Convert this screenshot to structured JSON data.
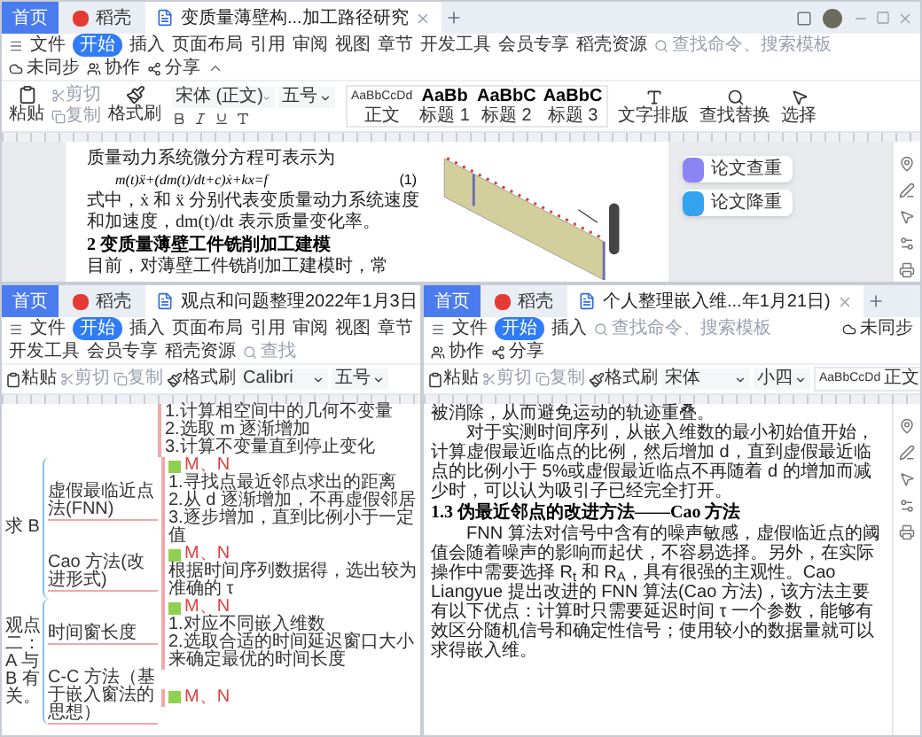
{
  "windows": [
    {
      "tabs": [
        {
          "label": "首页",
          "kind": "home",
          "selected": false
        },
        {
          "label": "稻壳",
          "kind": "daoke",
          "selected": false
        },
        {
          "label": "变质量薄壁构...加工路径研究",
          "kind": "doc",
          "selected": true
        }
      ],
      "menu": [
        {
          "label": "文件",
          "selected": false
        },
        {
          "label": "开始",
          "selected": true
        },
        {
          "label": "插入",
          "selected": false
        },
        {
          "label": "页面布局",
          "selected": false
        },
        {
          "label": "引用",
          "selected": false
        },
        {
          "label": "审阅",
          "selected": false
        },
        {
          "label": "视图",
          "selected": false
        },
        {
          "label": "章节",
          "selected": false
        },
        {
          "label": "开发工具",
          "selected": false
        },
        {
          "label": "会员专享",
          "selected": false
        },
        {
          "label": "稻壳资源",
          "selected": false
        }
      ],
      "search": {
        "placeholder": "查找命令、搜索模板"
      },
      "actions": [
        "未同步",
        "协作",
        "分享"
      ],
      "ribbon": {
        "clipboard": [
          "粘贴",
          "剪切",
          "复制",
          "格式刷"
        ],
        "font": "宋体 (正文)",
        "size": "五号",
        "styles": [
          {
            "sample": "AaBbCcDd",
            "label": "正文"
          },
          {
            "sample": "AaBb",
            "label": "标题 1"
          },
          {
            "sample": "AaBbC",
            "label": "标题 2"
          },
          {
            "sample": "AaBbC",
            "label": "标题 3"
          }
        ],
        "tools": [
          "文字排版",
          "查找替换",
          "选择"
        ]
      },
      "content": {
        "kind": "paper",
        "paragraphs": [
          {
            "kind": "text",
            "text": "质量动力系统微分方程可表示为"
          },
          {
            "kind": "formula",
            "text": "m(t)ẍ+(dm(t)/dt+c)ẋ+kx=f",
            "number": "(1)"
          },
          {
            "kind": "text",
            "text": "式中，ẋ 和 ẍ 分别代表变质量动力系统速度"
          },
          {
            "kind": "text",
            "text": "和加速度，dm(t)/dt 表示质量变化率。"
          },
          {
            "kind": "heading",
            "text": "2 变质量薄壁工件铣削加工建模"
          },
          {
            "kind": "text",
            "text": "目前，对薄壁工件铣削加工建模时，常"
          }
        ],
        "side_buttons": [
          "论文查重",
          "论文降重"
        ]
      }
    },
    {
      "tabs": [
        {
          "label": "首页",
          "kind": "home",
          "selected": false
        },
        {
          "label": "稻壳",
          "kind": "daoke",
          "selected": false
        },
        {
          "label": "观点和问题整理2022年1月3日",
          "kind": "doc",
          "selected": true
        }
      ],
      "menu": [
        {
          "label": "文件",
          "selected": false
        },
        {
          "label": "开始",
          "selected": true
        },
        {
          "label": "插入",
          "selected": false
        },
        {
          "label": "页面布局",
          "selected": false
        },
        {
          "label": "引用",
          "selected": false
        },
        {
          "label": "审阅",
          "selected": false
        },
        {
          "label": "视图",
          "selected": false
        },
        {
          "label": "章节",
          "selected": false
        },
        {
          "label": "开发工具",
          "selected": false
        },
        {
          "label": "会员专享",
          "selected": false
        },
        {
          "label": "稻壳资源",
          "selected": false
        }
      ],
      "search": {
        "placeholder": "查找"
      },
      "ribbon": {
        "clipboard": [
          "粘贴",
          "剪切",
          "复制",
          "格式刷"
        ],
        "font": "Calibri",
        "size": "五号"
      },
      "content": {
        "kind": "mindmap",
        "top_notes": [
          "1.计算相空间中的几何不变量",
          "2.选取 m 逐渐增加",
          "3.计算不变量直到停止变化"
        ],
        "groups": [
          {
            "label": "求 B",
            "branches": [
              {
                "label": "虚假最临近点法(FNN)",
                "tag": "M、N",
                "notes": [
                  "1.寻找点最近邻点求出的距离",
                  "2.从 d 逐渐增加，不再虚假邻居",
                  "3.逐步增加，直到比例小于一定值"
                ]
              },
              {
                "label": "Cao 方法(改进形式)",
                "tag": "M、N",
                "notes": [
                  "根据时间序列数据得，选出较为准确的 τ"
                ]
              }
            ]
          },
          {
            "label": "观点二：A 与 B 有关。",
            "branches": [
              {
                "label": "时间窗长度",
                "tag": "M、N",
                "notes": [
                  "1.对应不同嵌入维数",
                  "2.选取合适的时间延迟窗口大小来确定最优的时间长度"
                ]
              },
              {
                "label": "C-C 方法（基于嵌入窗法的思想）",
                "tag": "M、N"
              }
            ]
          }
        ]
      }
    },
    {
      "tabs": [
        {
          "label": "首页",
          "kind": "home",
          "selected": false
        },
        {
          "label": "稻壳",
          "kind": "daoke",
          "selected": false
        },
        {
          "label": "个人整理嵌入维...年1月21日)",
          "kind": "doc",
          "selected": true
        }
      ],
      "menu": [
        {
          "label": "文件",
          "selected": false
        },
        {
          "label": "开始",
          "selected": true
        },
        {
          "label": "插入",
          "selected": false
        }
      ],
      "search": {
        "placeholder": "查找命令、搜索模板"
      },
      "actions": [
        "未同步",
        "协作",
        "分享"
      ],
      "ribbon": {
        "clipboard": [
          "粘贴",
          "剪切",
          "复制",
          "格式刷"
        ],
        "font": "宋体",
        "size": "小四",
        "styles": [
          {
            "sample": "AaBbCcDd",
            "label": "正文"
          }
        ]
      },
      "content": {
        "kind": "text",
        "paragraphs": [
          {
            "kind": "text",
            "indent": false,
            "text": "被消除，从而避免运动的轨迹重叠。"
          },
          {
            "kind": "text",
            "indent": true,
            "text": "对于实测时间序列，从嵌入维数的最小初始值开始，计算虚假最近临点的比例，然后增加 d，直到虚假最近临点的比例小于 5%或虚假最近临点不再随着 d 的增加而减少时，可以认为吸引子已经完全打开。"
          },
          {
            "kind": "heading",
            "indent": false,
            "text": "1.3 伪最近邻点的改进方法——Cao 方法"
          },
          {
            "kind": "text",
            "indent": true,
            "text": "FNN 算法对信号中含有的噪声敏感，虚假临近点的阈值会随着噪声的影响而起伏，不容易选择。另外，在实际操作中需要选择 R$_{t}$ 和 R$_{A}$，具有很强的主观性。Cao Liangyue 提出改进的 FNN 算法(Cao 方法)，该方法主要有以下优点：计算时只需要延迟时间 τ 一个参数，能够有效区分随机信号和确定性信号；使用较小的数据量就可以求得嵌入维。"
          }
        ]
      }
    }
  ]
}
